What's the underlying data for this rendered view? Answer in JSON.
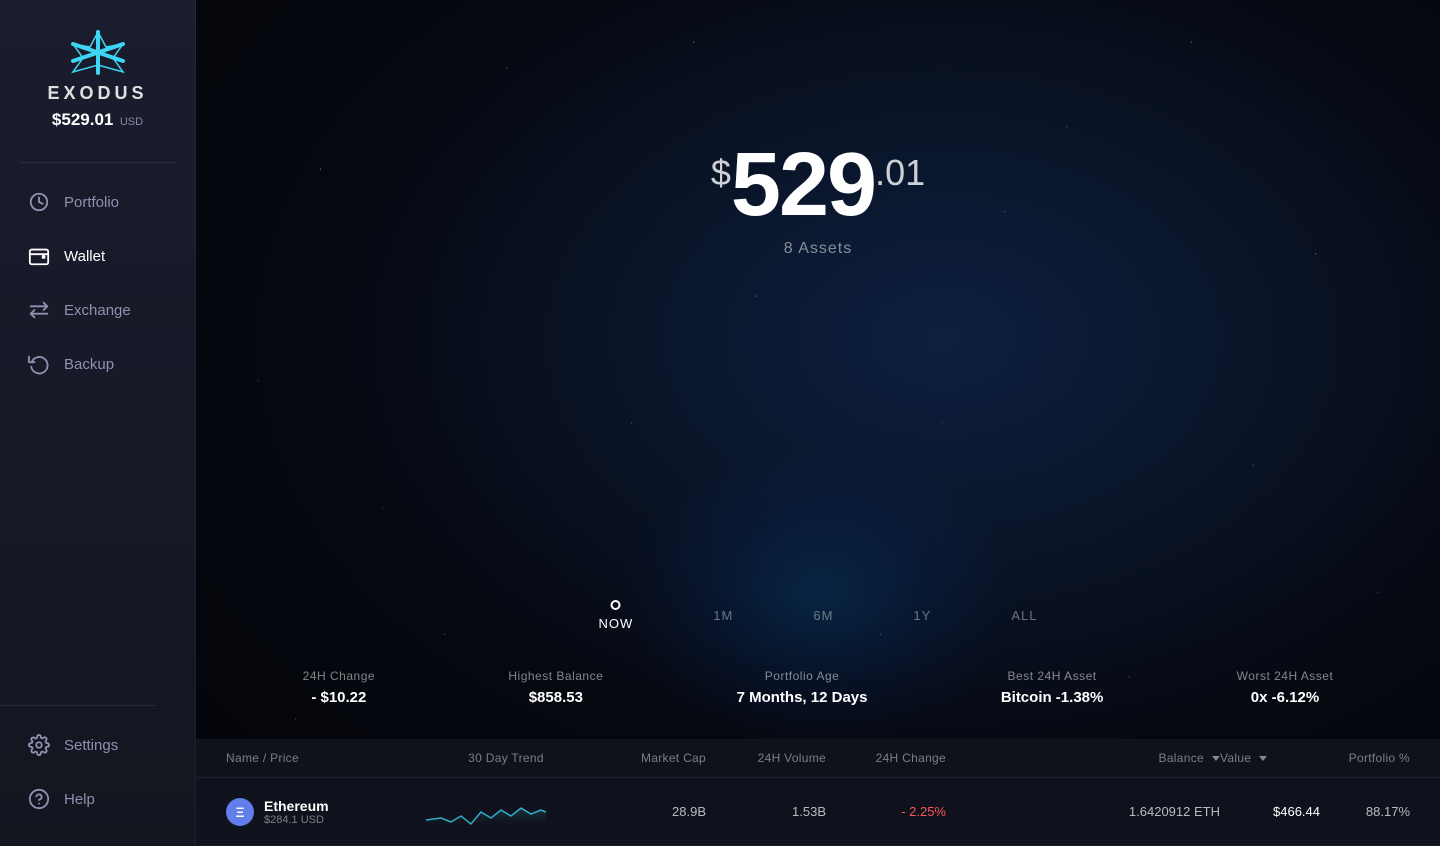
{
  "app": {
    "name": "EXODUS",
    "logo_alt": "Exodus Logo"
  },
  "sidebar": {
    "balance": "$529.01",
    "balance_big": "529",
    "balance_cents": ".01",
    "currency": "USD",
    "nav_items": [
      {
        "id": "portfolio",
        "label": "Portfolio",
        "icon": "clock-icon"
      },
      {
        "id": "wallet",
        "label": "Wallet",
        "icon": "wallet-icon",
        "active": true
      },
      {
        "id": "exchange",
        "label": "Exchange",
        "icon": "exchange-icon"
      },
      {
        "id": "backup",
        "label": "Backup",
        "icon": "backup-icon"
      }
    ],
    "bottom_items": [
      {
        "id": "settings",
        "label": "Settings",
        "icon": "settings-icon"
      },
      {
        "id": "help",
        "label": "Help",
        "icon": "help-icon"
      }
    ]
  },
  "portfolio": {
    "total_dollar": "$",
    "total_main": "529",
    "total_cents": ".01",
    "assets_count": "8 Assets"
  },
  "time_options": [
    {
      "id": "now",
      "label": "NOW",
      "active": true
    },
    {
      "id": "1m",
      "label": "1M",
      "active": false
    },
    {
      "id": "6m",
      "label": "6M",
      "active": false
    },
    {
      "id": "1y",
      "label": "1Y",
      "active": false
    },
    {
      "id": "all",
      "label": "ALL",
      "active": false
    }
  ],
  "stats": [
    {
      "label": "24H Change",
      "value": "- $10.22"
    },
    {
      "label": "Highest Balance",
      "value": "$858.53"
    },
    {
      "label": "Portfolio Age",
      "value": "7 Months, 12 Days"
    },
    {
      "label": "Best 24H Asset",
      "value": "Bitcoin -1.38%"
    },
    {
      "label": "Worst 24H Asset",
      "value": "0x -6.12%"
    }
  ],
  "table": {
    "headers": {
      "name_price": "Name / Price",
      "trend": "30 Day Trend",
      "market_cap": "Market Cap",
      "volume": "24H Volume",
      "change": "24H Change",
      "balance": "Balance",
      "value": "Value",
      "portfolio": "Portfolio %"
    },
    "rows": [
      {
        "name": "Ethereum",
        "price": "$284.1 USD",
        "icon": "ETH",
        "icon_color": "#627eea",
        "market_cap": "28.9B",
        "volume": "1.53B",
        "change": "- 2.25%",
        "balance": "1.6420912 ETH",
        "value": "$466.44",
        "portfolio": "88.17%"
      }
    ]
  },
  "colors": {
    "accent_blue": "#4dabf7",
    "negative": "#ff5555",
    "sidebar_bg": "#1a1d2e",
    "main_bg": "#060810"
  }
}
